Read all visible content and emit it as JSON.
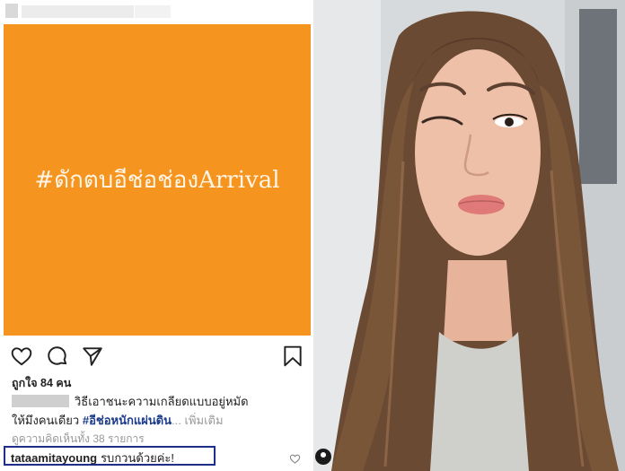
{
  "post": {
    "image_text": "#ดักตบอีช่อช่องArrival",
    "background_color": "#f5941e"
  },
  "actions": {
    "like_icon": "heart-icon",
    "comment_icon": "comment-icon",
    "share_icon": "send-icon",
    "save_icon": "bookmark-icon"
  },
  "likes": "ถูกใจ 84 คน",
  "caption": {
    "line1": "วิธีเอาชนะความเกลียดแบบอยู่หมัด",
    "line2_prefix": "ให้มึงคนเดียว ",
    "hashtag": "#อีช่อหนักแผ่นดิน",
    "more": "... เพิ่มเติม"
  },
  "view_comments": "ดูความคิดเห็นทั้ง 38 รายการ",
  "comment": {
    "username": "tataamitayoung",
    "text": "รบกวนด้วยค่ะ!"
  },
  "highlight_color": "#1f2d8c"
}
